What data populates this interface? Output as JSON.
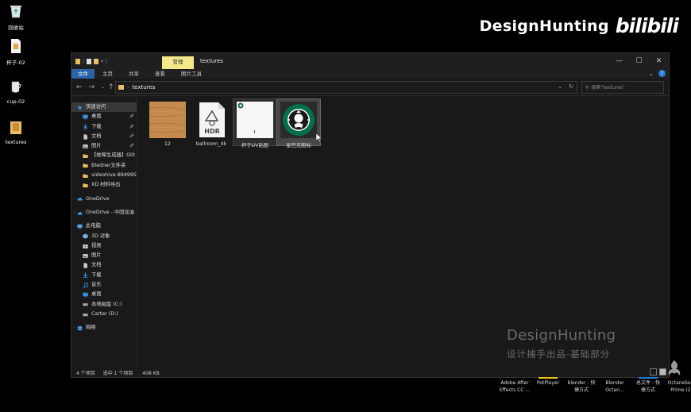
{
  "desktop": {
    "icons": [
      {
        "label": "回收站"
      },
      {
        "label": "杯子-02"
      },
      {
        "label": "cup-02"
      },
      {
        "label": "textures"
      }
    ]
  },
  "watermark": {
    "name": "DesignHunting",
    "bili": "bilibili",
    "bottom_name": "DesignHunting",
    "bottom_sub": "设计捕手出品-基础部分"
  },
  "window": {
    "title": "textures",
    "context_tab": "管理",
    "ribbon_tabs": [
      "文件",
      "主页",
      "共享",
      "查看",
      "图片工具"
    ],
    "controls": [
      "—",
      "☐",
      "✕"
    ],
    "address": {
      "path": "textures",
      "refresh": "↻"
    },
    "search": {
      "placeholder": "搜索\"textures\""
    },
    "status": {
      "count": "4 个项目",
      "selection": "选中 1 个项目",
      "size": "408 KB"
    }
  },
  "sidebar": {
    "items": [
      {
        "label": "快速访问",
        "icon": "star-icon",
        "color": "#3a8ee6",
        "kind": "header",
        "active": true
      },
      {
        "label": "桌面",
        "icon": "desktop-icon",
        "color": "#3a8ee6",
        "pin": true
      },
      {
        "label": "下载",
        "icon": "download-icon",
        "color": "#3a8ee6",
        "pin": true
      },
      {
        "label": "文档",
        "icon": "document-icon",
        "color": "#cccccc",
        "pin": true
      },
      {
        "label": "图片",
        "icon": "picture-icon",
        "color": "#cccccc",
        "pin": true
      },
      {
        "label": "【故障生成器】Glit",
        "icon": "folder-icon",
        "color": "#e8c060"
      },
      {
        "label": "Bledner文件夹",
        "icon": "folder-icon",
        "color": "#e8c060"
      },
      {
        "label": "videohive-894995",
        "icon": "folder-icon",
        "color": "#e8c060"
      },
      {
        "label": "XD 材料导出",
        "icon": "folder-icon",
        "color": "#e8c060"
      },
      {
        "gap": true
      },
      {
        "label": "OneDrive",
        "icon": "cloud-icon",
        "color": "#3a8ee6",
        "kind": "header"
      },
      {
        "gap": true
      },
      {
        "label": "OneDrive - 中国加油",
        "icon": "cloud-icon",
        "color": "#3a8ee6",
        "kind": "header"
      },
      {
        "gap": true
      },
      {
        "label": "此电脑",
        "icon": "computer-icon",
        "color": "#5aa0e6",
        "kind": "header"
      },
      {
        "label": "3D 对象",
        "icon": "cube-icon",
        "color": "#7ab0e8"
      },
      {
        "label": "视频",
        "icon": "video-icon",
        "color": "#cccccc"
      },
      {
        "label": "图片",
        "icon": "picture-icon",
        "color": "#cccccc"
      },
      {
        "label": "文档",
        "icon": "document-icon",
        "color": "#cccccc"
      },
      {
        "label": "下载",
        "icon": "download-icon",
        "color": "#3a8ee6"
      },
      {
        "label": "音乐",
        "icon": "music-icon",
        "color": "#3a8ee6"
      },
      {
        "label": "桌面",
        "icon": "desktop-icon",
        "color": "#3a8ee6"
      },
      {
        "label": "本地磁盘 (C:)",
        "icon": "drive-icon",
        "color": "#aaaaaa"
      },
      {
        "label": "Carter (D:)",
        "icon": "drive-icon",
        "color": "#aaaaaa"
      },
      {
        "gap": true
      },
      {
        "label": "网络",
        "icon": "network-icon",
        "color": "#5aa0e6",
        "kind": "header"
      }
    ]
  },
  "files": [
    {
      "label": "12",
      "thumb": "wood-texture",
      "state": "normal"
    },
    {
      "label": "ballroom_4k",
      "thumb": "hdr-file",
      "hdr_text": "HDR",
      "state": "normal"
    },
    {
      "label": "杯子UV贴图",
      "thumb": "uv-map",
      "state": "hover"
    },
    {
      "label": "星巴克图标",
      "thumb": "starbucks-logo",
      "state": "selected"
    }
  ],
  "taskbar": {
    "apps": [
      {
        "label1": "Adobe After",
        "label2": "Effects CC ...",
        "bar_color": ""
      },
      {
        "label1": "PotPlayer",
        "label2": "",
        "bar_color": "#f3c313"
      },
      {
        "label1": "blender - 快",
        "label2": "捷方式",
        "bar_color": ""
      },
      {
        "label1": "Blender",
        "label2": "Octan...",
        "bar_color": ""
      },
      {
        "label1": "总文件 - 快",
        "label2": "捷方式",
        "bar_color": "#2a7ad8"
      },
      {
        "label1": "OctaneSe...",
        "label2": "Prime (2)",
        "bar_color": ""
      }
    ]
  }
}
